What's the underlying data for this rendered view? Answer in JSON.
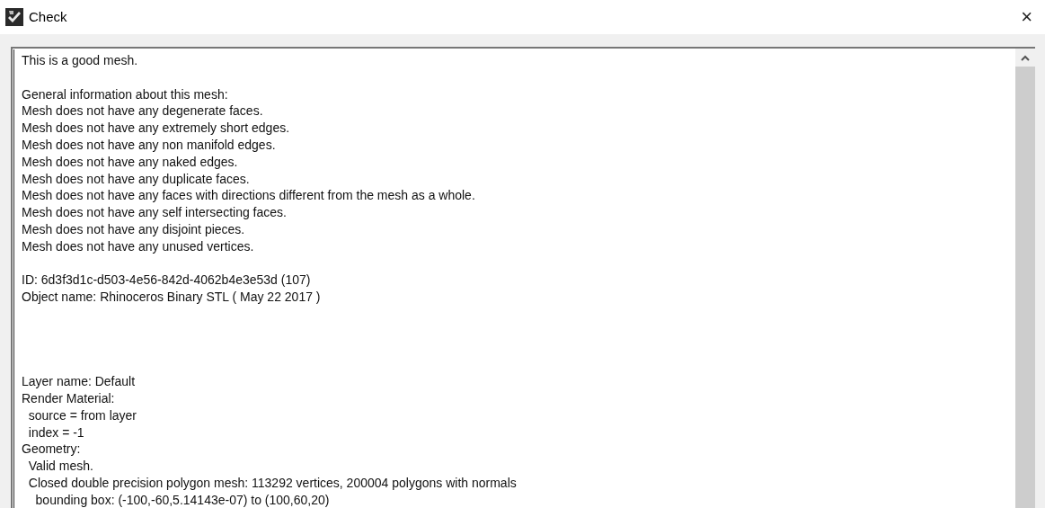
{
  "window": {
    "title": "Check",
    "close": "×"
  },
  "report": {
    "text": "This is a good mesh.\n\nGeneral information about this mesh:\nMesh does not have any degenerate faces.\nMesh does not have any extremely short edges.\nMesh does not have any non manifold edges.\nMesh does not have any naked edges.\nMesh does not have any duplicate faces.\nMesh does not have any faces with directions different from the mesh as a whole.\nMesh does not have any self intersecting faces.\nMesh does not have any disjoint pieces.\nMesh does not have any unused vertices.\n\nID: 6d3f3d1c-d503-4e56-842d-4062b4e3e53d (107)\nObject name: Rhinoceros Binary STL ( May 22 2017 )\n\n\n\n\nLayer name: Default\nRender Material:\n  source = from layer\n  index = -1\nGeometry:\n  Valid mesh.\n  Closed double precision polygon mesh: 113292 vertices, 200004 polygons with normals\n    bounding box: (-100,-60,5.14143e-07) to (100,60,20)"
  }
}
